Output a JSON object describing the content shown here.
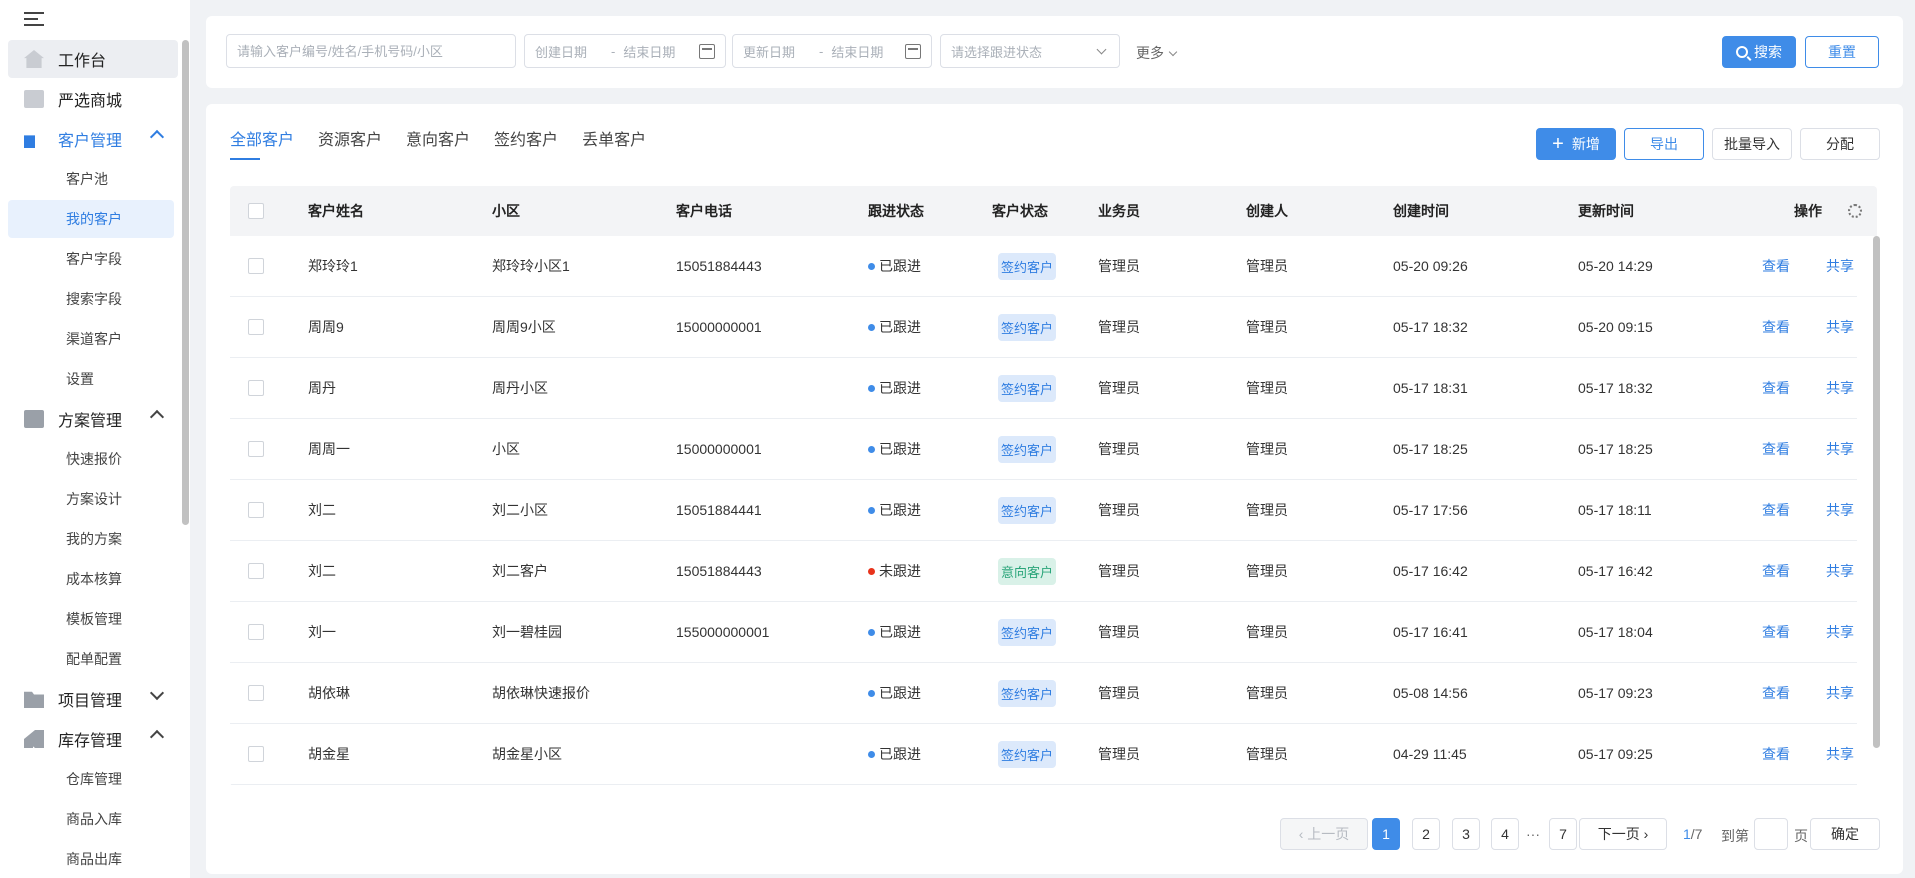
{
  "sidebar": {
    "top_items": [
      {
        "label": "工作台",
        "icon": "home-icon"
      },
      {
        "label": "严选商城",
        "icon": "shop-icon"
      }
    ],
    "customer_group": {
      "label": "客户管理",
      "icon": "user-icon",
      "items": [
        "客户池",
        "我的客户",
        "客户字段",
        "搜索字段",
        "渠道客户",
        "设置"
      ]
    },
    "plan_group": {
      "label": "方案管理",
      "icon": "document-icon",
      "items": [
        "快速报价",
        "方案设计",
        "我的方案",
        "成本核算",
        "模板管理",
        "配单配置"
      ]
    },
    "project_group": {
      "label": "项目管理",
      "icon": "folder-icon"
    },
    "stock_group": {
      "label": "库存管理",
      "icon": "box-icon",
      "items": [
        "仓库管理",
        "商品入库",
        "商品出库"
      ]
    }
  },
  "search": {
    "keyword_placeholder": "请输入客户编号/姓名/手机号码/小区",
    "create_start_placeholder": "创建日期",
    "create_end_placeholder": "结束日期",
    "update_start_placeholder": "更新日期",
    "update_end_placeholder": "结束日期",
    "status_placeholder": "请选择跟进状态",
    "more_label": "更多",
    "search_label": "搜索",
    "reset_label": "重置"
  },
  "tabs": [
    "全部客户",
    "资源客户",
    "意向客户",
    "签约客户",
    "丢单客户"
  ],
  "actions": {
    "add_label": "新增",
    "export_label": "导出",
    "import_label": "批量导入",
    "assign_label": "分配"
  },
  "table": {
    "headers": {
      "name": "客户姓名",
      "community": "小区",
      "phone": "客户电话",
      "follow": "跟进状态",
      "status": "客户状态",
      "salesman": "业务员",
      "creator": "创建人",
      "created": "创建时间",
      "updated": "更新时间",
      "ops": "操作"
    },
    "view_label": "查看",
    "share_label": "共享",
    "status_colors": {
      "followed": "#3f8ce8",
      "not_followed": "#e8331b"
    },
    "rows": [
      {
        "name": "郑玲玲1",
        "community": "郑玲玲小区1",
        "phone": "15051884443",
        "follow": "已跟进",
        "follow_key": "followed",
        "status": "签约客户",
        "status_key": "sign",
        "salesman": "管理员",
        "creator": "管理员",
        "created": "05-20 09:26",
        "updated": "05-20 14:29"
      },
      {
        "name": "周周9",
        "community": "周周9小区",
        "phone": "15000000001",
        "follow": "已跟进",
        "follow_key": "followed",
        "status": "签约客户",
        "status_key": "sign",
        "salesman": "管理员",
        "creator": "管理员",
        "created": "05-17 18:32",
        "updated": "05-20 09:15"
      },
      {
        "name": "周丹",
        "community": "周丹小区",
        "phone": "",
        "follow": "已跟进",
        "follow_key": "followed",
        "status": "签约客户",
        "status_key": "sign",
        "salesman": "管理员",
        "creator": "管理员",
        "created": "05-17 18:31",
        "updated": "05-17 18:32"
      },
      {
        "name": "周周一",
        "community": "小区",
        "phone": "15000000001",
        "follow": "已跟进",
        "follow_key": "followed",
        "status": "签约客户",
        "status_key": "sign",
        "salesman": "管理员",
        "creator": "管理员",
        "created": "05-17 18:25",
        "updated": "05-17 18:25"
      },
      {
        "name": "刘二",
        "community": "刘二小区",
        "phone": "15051884441",
        "follow": "已跟进",
        "follow_key": "followed",
        "status": "签约客户",
        "status_key": "sign",
        "salesman": "管理员",
        "creator": "管理员",
        "created": "05-17 17:56",
        "updated": "05-17 18:11"
      },
      {
        "name": "刘二",
        "community": "刘二客户",
        "phone": "15051884443",
        "follow": "未跟进",
        "follow_key": "not_followed",
        "status": "意向客户",
        "status_key": "intent",
        "salesman": "管理员",
        "creator": "管理员",
        "created": "05-17 16:42",
        "updated": "05-17 16:42"
      },
      {
        "name": "刘一",
        "community": "刘一碧桂园",
        "phone": "155000000001",
        "follow": "已跟进",
        "follow_key": "followed",
        "status": "签约客户",
        "status_key": "sign",
        "salesman": "管理员",
        "creator": "管理员",
        "created": "05-17 16:41",
        "updated": "05-17 18:04"
      },
      {
        "name": "胡依琳",
        "community": "胡依琳快速报价",
        "phone": "",
        "follow": "已跟进",
        "follow_key": "followed",
        "status": "签约客户",
        "status_key": "sign",
        "salesman": "管理员",
        "creator": "管理员",
        "created": "05-08 14:56",
        "updated": "05-17 09:23"
      },
      {
        "name": "胡金星",
        "community": "胡金星小区",
        "phone": "",
        "follow": "已跟进",
        "follow_key": "followed",
        "status": "签约客户",
        "status_key": "sign",
        "salesman": "管理员",
        "creator": "管理员",
        "created": "04-29 11:45",
        "updated": "05-17 09:25"
      }
    ]
  },
  "pagination": {
    "prev_label": "上一页",
    "next_label": "下一页",
    "pages": [
      "1",
      "2",
      "3",
      "4",
      "···",
      "7"
    ],
    "current_page": "1",
    "page_info_current": "1",
    "page_info_total": "/7",
    "goto_label": "到第",
    "page_unit": "页",
    "confirm_label": "确定"
  }
}
